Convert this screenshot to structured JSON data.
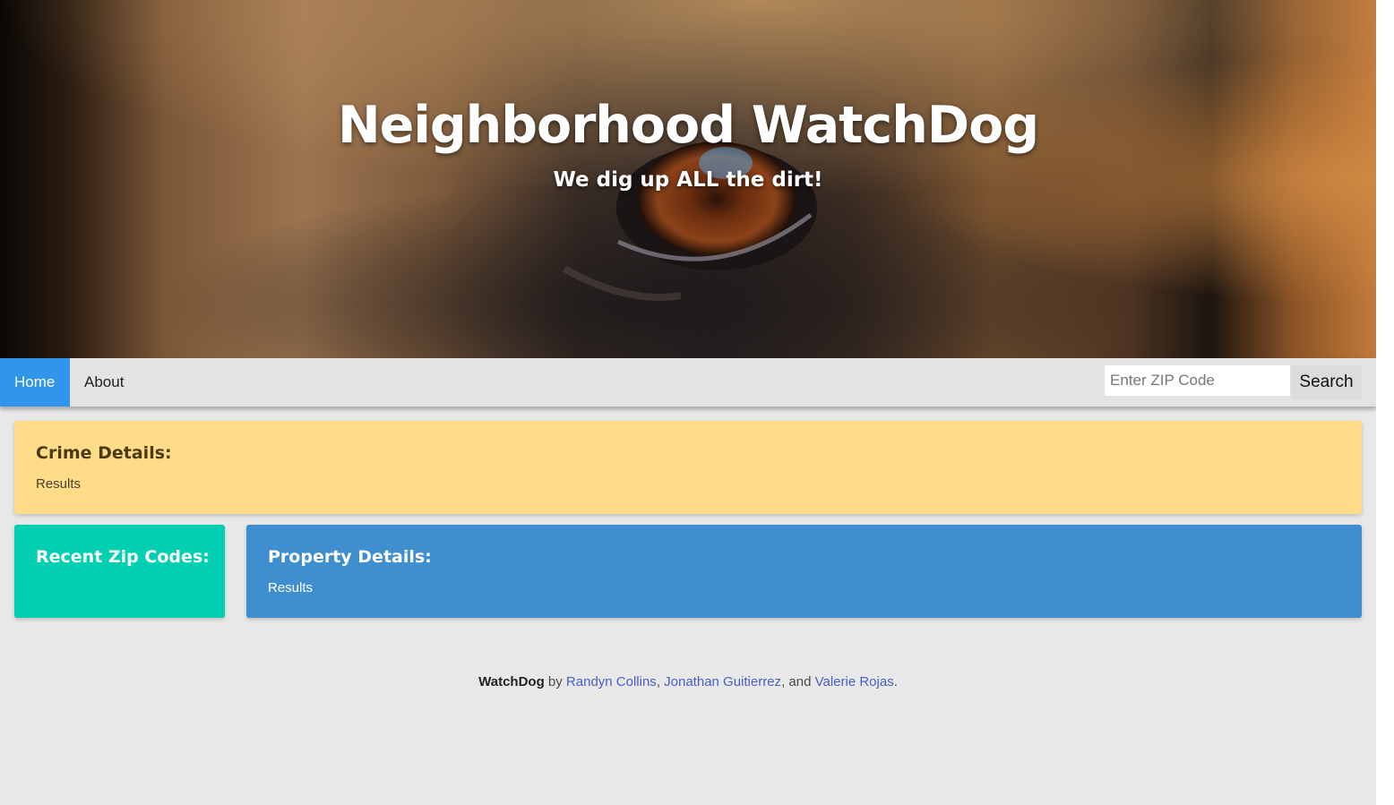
{
  "hero": {
    "title": "Neighborhood WatchDog",
    "subtitle": "We dig up ALL the dirt!"
  },
  "nav": {
    "items": [
      {
        "label": "Home",
        "active": true
      },
      {
        "label": "About",
        "active": false
      }
    ],
    "search_placeholder": "Enter ZIP Code",
    "search_value": "",
    "search_button_label": "Search"
  },
  "cards": {
    "crime": {
      "title": "Crime Details:",
      "body": "Results"
    },
    "recent_zips": {
      "title": "Recent Zip Codes:",
      "items": []
    },
    "property": {
      "title": "Property Details:",
      "body": "Results"
    }
  },
  "footer": {
    "brand": "WatchDog",
    "by": "by",
    "authors": [
      "Randyn Collins",
      "Jonathan Guitierrez",
      "Valerie Rojas"
    ],
    "sep1": ",",
    "sep2": ", and",
    "end": "."
  },
  "colors": {
    "nav_active": "#2f96e9",
    "crime_card": "#ffdd88",
    "zips_card": "#00cfb1",
    "property_card": "#3e8ed0",
    "link": "#485fc7",
    "page_bg": "#e8e8e8"
  }
}
